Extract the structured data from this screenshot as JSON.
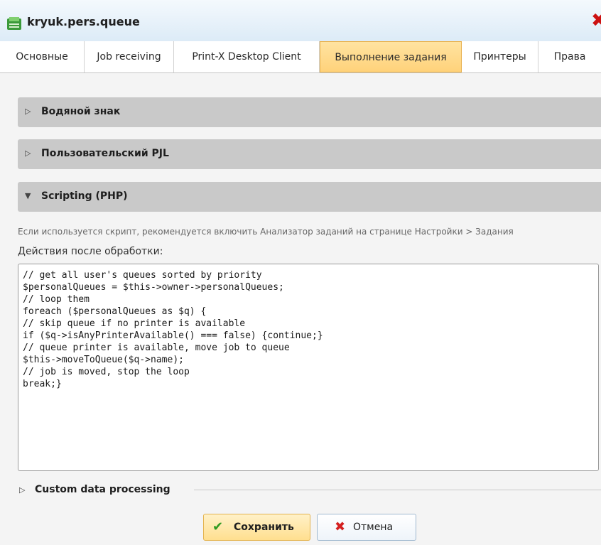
{
  "window": {
    "title": "kryuk.pers.queue",
    "icon": "queue-icon",
    "close_icon": "close-icon",
    "close_color": "#cc1111"
  },
  "tabs": [
    {
      "label": "Основные"
    },
    {
      "label": "Job receiving"
    },
    {
      "label": "Print-X Desktop Client"
    },
    {
      "label": "Выполнение задания",
      "active": true
    },
    {
      "label": "Принтеры"
    },
    {
      "label": "Права"
    }
  ],
  "sections": {
    "watermark": {
      "label": "Водяной знак",
      "state": "collapsed"
    },
    "pjl": {
      "label": "Пользовательский PJL",
      "state": "collapsed"
    },
    "scripting": {
      "label": "Scripting (PHP)",
      "state": "expanded"
    }
  },
  "scripting": {
    "hint": "Если используется скрипт, рекомендуется включить Анализатор заданий на странице Настройки > Задания",
    "field_label": "Действия после обработки:",
    "code_lines": [
      "// get all user's queues sorted by priority",
      "$personalQueues = $this->owner->personalQueues;",
      "// loop them",
      "foreach ($personalQueues as $q) {",
      "// skip queue if no printer is available",
      "if ($q->isAnyPrinterAvailable() === false) {continue;}",
      "// queue printer is available, move job to queue",
      "$this->moveToQueue($q->name);",
      "// job is moved, stop the loop",
      "break;}"
    ]
  },
  "custom_data": {
    "label": "Custom data processing",
    "state": "collapsed"
  },
  "buttons": {
    "save_label": "Сохранить",
    "save_icon": "checkmark-icon",
    "cancel_label": "Отмена",
    "cancel_icon": "x-icon"
  },
  "colors": {
    "active_tab": "#ffd27a",
    "section_header": "#c9c9c9",
    "save_check": "#2f9a22",
    "cancel_x": "#d42020"
  }
}
